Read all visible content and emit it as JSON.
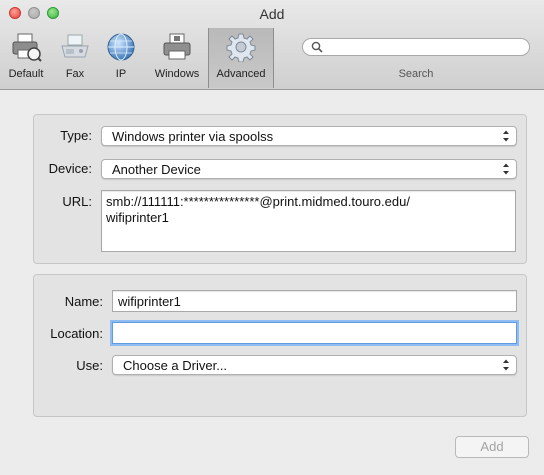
{
  "window": {
    "title": "Add"
  },
  "toolbar": {
    "items": [
      {
        "label": "Default",
        "icon": "default-printer-icon"
      },
      {
        "label": "Fax",
        "icon": "fax-icon"
      },
      {
        "label": "IP",
        "icon": "globe-icon"
      },
      {
        "label": "Windows",
        "icon": "windows-printer-icon"
      },
      {
        "label": "Advanced",
        "icon": "gear-icon",
        "selected": true
      }
    ],
    "search": {
      "label": "Search",
      "placeholder": ""
    }
  },
  "connection": {
    "type_label": "Type:",
    "type_value": "Windows printer via spoolss",
    "device_label": "Device:",
    "device_value": "Another Device",
    "url_label": "URL:",
    "url_value": "smb://111111:***************@print.midmed.touro.edu/\nwifiprinter1"
  },
  "printer": {
    "name_label": "Name:",
    "name_value": "wifiprinter1",
    "location_label": "Location:",
    "location_value": "",
    "use_label": "Use:",
    "use_value": "Choose a Driver..."
  },
  "footer": {
    "add_label": "Add"
  },
  "colors": {
    "focus_ring": "#8fbdf1",
    "close": "#e0443e",
    "minimize": "#a9a9a9",
    "zoom": "#34b53c"
  }
}
